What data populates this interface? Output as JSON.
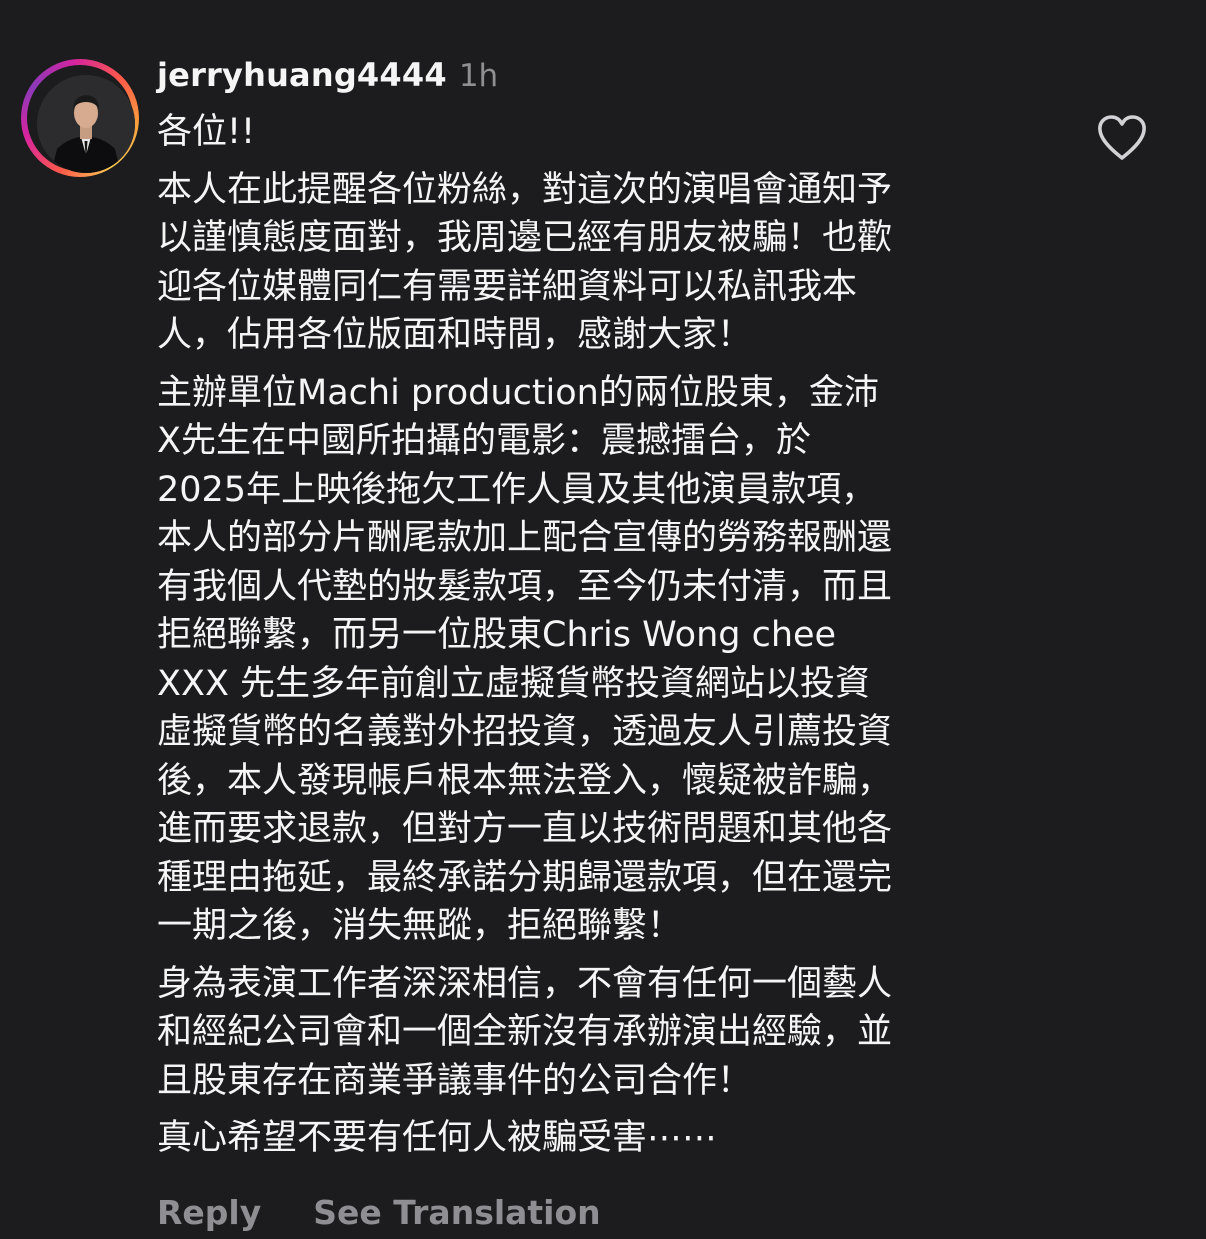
{
  "comment": {
    "username": "jerryhuang4444",
    "time": "1h",
    "avatar_icon": "profile-photo",
    "like_icon": "heart-outline-icon",
    "paragraphs": [
      [
        "各位!!"
      ],
      [
        "本人在此提醒各位粉絲，對這次的演唱會通知予",
        "以謹慎態度面對，我周邊已經有朋友被騙！也歡",
        "迎各位媒體同仁有需要詳細資料可以私訊我本",
        "人，佔用各位版面和時間，感謝大家！"
      ],
      [
        "主辦單位Machi production的兩位股東，金沛",
        "X先生在中國所拍攝的電影：震撼擂台，於",
        "2025年上映後拖欠工作人員及其他演員款項，",
        "本人的部分片酬尾款加上配合宣傳的勞務報酬還",
        "有我個人代墊的妝髮款項，至今仍未付清，而且",
        "拒絕聯繫，而另一位股東Chris Wong chee",
        "XXX 先生多年前創立虛擬貨幣投資網站以投資",
        "虛擬貨幣的名義對外招投資，透過友人引薦投資",
        "後，本人發現帳戶根本無法登入，懷疑被詐騙，",
        "進而要求退款，但對方一直以技術問題和其他各",
        "種理由拖延，最終承諾分期歸還款項，但在還完",
        "一期之後，消失無蹤，拒絕聯繫！"
      ],
      [
        "身為表演工作者深深相信，不會有任何一個藝人",
        "和經紀公司會和一個全新沒有承辦演出經驗，並",
        "且股東存在商業爭議事件的公司合作！"
      ],
      [
        "真心希望不要有任何人被騙受害⋯⋯"
      ]
    ],
    "actions": {
      "reply": "Reply",
      "see_translation": "See Translation"
    }
  },
  "colors": {
    "background": "#1c1c1e",
    "text": "#f5f5f5",
    "secondary": "#8e8e93"
  }
}
